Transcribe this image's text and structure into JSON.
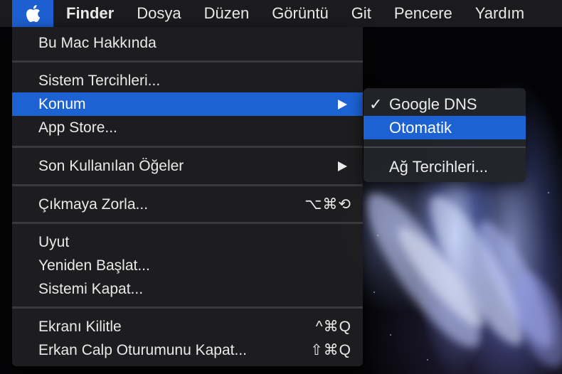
{
  "menubar": {
    "items": [
      {
        "label": "Finder",
        "bold": true
      },
      {
        "label": "Dosya"
      },
      {
        "label": "Düzen"
      },
      {
        "label": "Görüntü"
      },
      {
        "label": "Git"
      },
      {
        "label": "Pencere"
      },
      {
        "label": "Yardım"
      }
    ]
  },
  "apple_menu": {
    "about": "Bu Mac Hakkında",
    "system_prefs": "Sistem Tercihleri...",
    "location": "Konum",
    "app_store": "App Store...",
    "recent_items": "Son Kullanılan Öğeler",
    "force_quit": "Çıkmaya Zorla...",
    "force_quit_shortcut": "⌥⌘⟲",
    "sleep": "Uyut",
    "restart": "Yeniden Başlat...",
    "shutdown": "Sistemi Kapat...",
    "lock_screen": "Ekranı Kilitle",
    "lock_screen_shortcut": "^⌘Q",
    "logout": "Erkan Calp Oturumunu Kapat...",
    "logout_shortcut": "⇧⌘Q"
  },
  "location_submenu": {
    "check_mark": "✓",
    "google_dns": "Google DNS",
    "automatic": "Otomatik",
    "network_prefs": "Ağ Tercihleri..."
  },
  "colors": {
    "highlight": "#1c62d3",
    "menubar_bg": "#1b1b1d",
    "menu_bg": "#1e1e20"
  }
}
